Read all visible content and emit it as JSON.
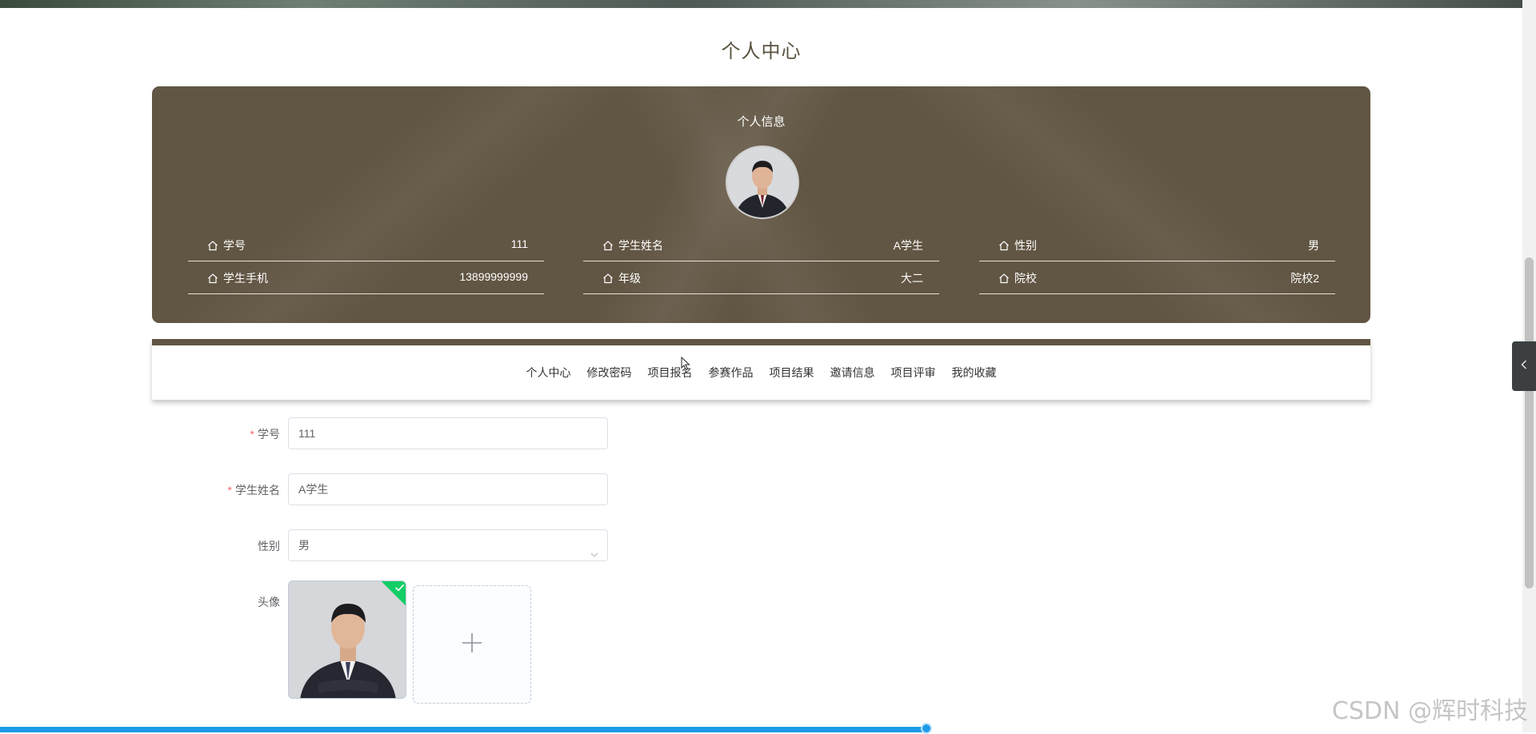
{
  "page_title": "个人中心",
  "info_card": {
    "title": "个人信息",
    "fields": [
      [
        {
          "label": "学号",
          "value": "111"
        },
        {
          "label": "学生姓名",
          "value": "A学生"
        },
        {
          "label": "性别",
          "value": "男"
        }
      ],
      [
        {
          "label": "学生手机",
          "value": "13899999999"
        },
        {
          "label": "年级",
          "value": "大二"
        },
        {
          "label": "院校",
          "value": "院校2"
        }
      ]
    ]
  },
  "nav": [
    "个人中心",
    "修改密码",
    "项目报名",
    "参赛作品",
    "项目结果",
    "邀请信息",
    "项目评审",
    "我的收藏"
  ],
  "form": {
    "student_id": {
      "label": "学号",
      "value": "111"
    },
    "student_name": {
      "label": "学生姓名",
      "value": "A学生"
    },
    "gender": {
      "label": "性别",
      "value": "男"
    },
    "avatar": {
      "label": "头像"
    }
  },
  "watermark": "CSDN @辉时科技",
  "colors": {
    "brand": "#615543",
    "required": "#f56c6c",
    "success": "#13ce66",
    "progress": "#1e9be8"
  }
}
